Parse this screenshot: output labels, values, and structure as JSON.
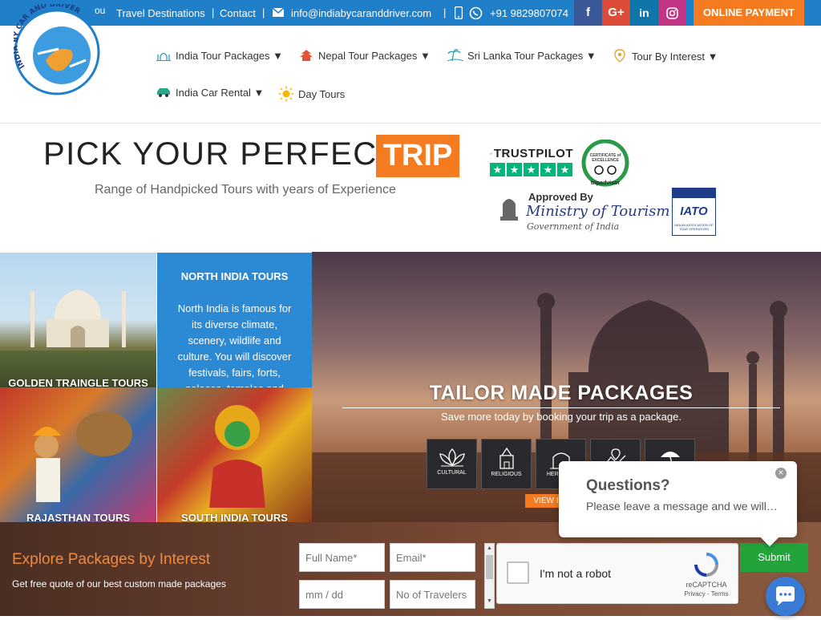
{
  "topbar": {
    "cutoff_text": "ou",
    "links": [
      "Travel Destinations",
      "Contact"
    ],
    "email": "info@indiabycaranddriver.com",
    "phone": "+91 9829807074",
    "social": [
      "f",
      "G+",
      "in",
      "ig"
    ],
    "payment_label": "ONLINE PAYMENT"
  },
  "logo": {
    "text": "INDIA BY CAR AND DRIVER"
  },
  "nav": {
    "items": [
      "India Tour Packages ▼",
      "Nepal Tour Packages ▼",
      "Sri Lanka Tour Packages ▼",
      "Tour By Interest ▼",
      "India Car Rental ▼",
      "Day Tours"
    ]
  },
  "hero": {
    "title": "PICK YOUR PERFECT",
    "highlight": "TRIP",
    "subtitle": "Range of Handpicked Tours with years of Experience"
  },
  "badges": {
    "trustpilot": "TRUSTPILOT",
    "tripadvisor_certificate": "CERTIFICATE of EXCELLENCE",
    "tripadvisor_brand": "tripadvisor",
    "ministry_approved": "Approved By",
    "ministry_name": "Ministry of Tourism",
    "ministry_gov": "Government of India",
    "iato": "IATO",
    "iato_name": "INDIAN ASSOCIATION OF TOUR OPERATORS"
  },
  "tiles": {
    "golden": "GOLDEN TRAINGLE TOURS",
    "rajasthan": "RAJASTHAN TOURS",
    "south": "SOUTH INDIA TOURS",
    "north_title": "NORTH INDIA TOURS",
    "north_text": "North India is famous for its diverse climate, scenery, wildlife and culture. You will discover festivals, fairs, forts, palaces, temples and"
  },
  "banner": {
    "title": "TAILOR MADE PACKAGES",
    "subtitle": "Save more today by booking your trip as a package.",
    "icons": [
      "CULTURAL",
      "RELIGIOUS",
      "HERITAGE",
      "",
      ""
    ],
    "view_button": "VIEW IT"
  },
  "form": {
    "heading": "Explore Packages by Interest",
    "subheading": "Get free quote of our best custom made packages",
    "fullname_placeholder": "Full Name*",
    "email_placeholder": "Email*",
    "date_placeholder": "mm / dd",
    "travelers_placeholder": "No of Travelers",
    "captcha_label": "I'm not a robot",
    "captcha_brand": "reCAPTCHA",
    "captcha_links": "Privacy - Terms",
    "submit_label": "Submit"
  },
  "chat": {
    "title": "Questions?",
    "message": "Please leave a message and we will…",
    "close": "×"
  },
  "colors": {
    "brand_blue": "#1f7fc9",
    "accent_orange": "#f47b20",
    "submit_green": "#22a43a"
  }
}
